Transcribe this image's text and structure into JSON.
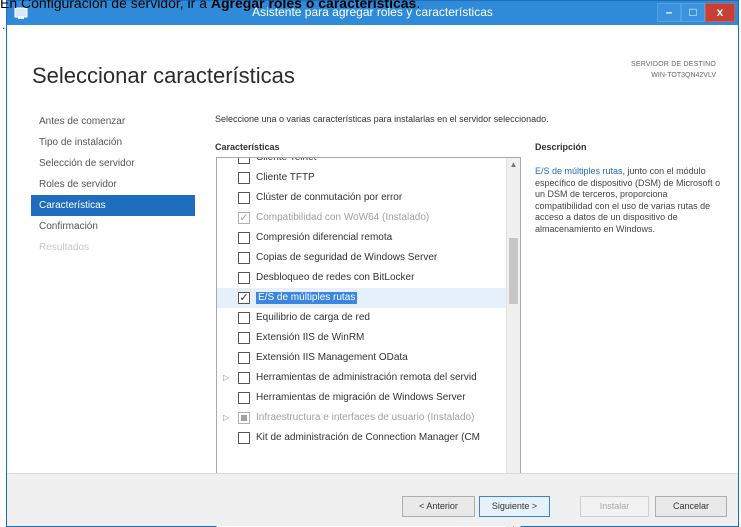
{
  "caption": {
    "prefix": "En Configuración de servidor, ir a ",
    "bold": "Agregar roles o características",
    "suffix": ".",
    "stray": "."
  },
  "window": {
    "title": "Asistente para agregar roles y características",
    "minimize_label": "–",
    "maximize_label": "□",
    "close_label": "x"
  },
  "header": {
    "title": "Seleccionar características",
    "destination_label": "SERVIDOR DE DESTINO",
    "destination_value": "WIN-TOT3QN42VLV"
  },
  "nav": {
    "items": [
      {
        "label": "Antes de comenzar",
        "state": "normal"
      },
      {
        "label": "Tipo de instalación",
        "state": "normal"
      },
      {
        "label": "Selección de servidor",
        "state": "normal"
      },
      {
        "label": "Roles de servidor",
        "state": "normal"
      },
      {
        "label": "Características",
        "state": "active"
      },
      {
        "label": "Confirmación",
        "state": "normal"
      },
      {
        "label": "Resultados",
        "state": "disabled"
      }
    ]
  },
  "main": {
    "instruction": "Seleccione una o varias características para instalarlas en el servidor seleccionado.",
    "features_heading": "Características",
    "description_heading": "Descripción"
  },
  "features": [
    {
      "label": "Cliente Telnet",
      "checked": false,
      "disabled": false,
      "expander": false,
      "selected": false
    },
    {
      "label": "Cliente TFTP",
      "checked": false,
      "disabled": false,
      "expander": false,
      "selected": false
    },
    {
      "label": "Clúster de conmutación por error",
      "checked": false,
      "disabled": false,
      "expander": false,
      "selected": false
    },
    {
      "label": "Compatibilidad con WoW64 (Instalado)",
      "checked": true,
      "disabled": true,
      "expander": false,
      "selected": false
    },
    {
      "label": "Compresión diferencial remota",
      "checked": false,
      "disabled": false,
      "expander": false,
      "selected": false
    },
    {
      "label": "Copias de seguridad de Windows Server",
      "checked": false,
      "disabled": false,
      "expander": false,
      "selected": false
    },
    {
      "label": "Desbloqueo de redes con BitLocker",
      "checked": false,
      "disabled": false,
      "expander": false,
      "selected": false
    },
    {
      "label": "E/S de múltiples rutas",
      "checked": true,
      "disabled": false,
      "expander": false,
      "selected": true
    },
    {
      "label": "Equilibrio de carga de red",
      "checked": false,
      "disabled": false,
      "expander": false,
      "selected": false
    },
    {
      "label": "Extensión IIS de WinRM",
      "checked": false,
      "disabled": false,
      "expander": false,
      "selected": false
    },
    {
      "label": "Extensión IIS Management OData",
      "checked": false,
      "disabled": false,
      "expander": false,
      "selected": false
    },
    {
      "label": "Herramientas de administración remota del servid",
      "checked": false,
      "disabled": false,
      "expander": true,
      "selected": false
    },
    {
      "label": "Herramientas de migración de Windows Server",
      "checked": false,
      "disabled": false,
      "expander": false,
      "selected": false
    },
    {
      "label": "Infraestructura e interfaces de usuario (Instalado)",
      "checked": false,
      "partial": true,
      "disabled": true,
      "expander": true,
      "selected": false
    },
    {
      "label": "Kit de administración de Connection Manager (CM",
      "checked": false,
      "disabled": false,
      "expander": false,
      "selected": false
    }
  ],
  "description": {
    "link_text": "E/S de múltiples rutas",
    "body": ", junto con el módulo específico de dispositivo (DSM) de Microsoft o un DSM de terceros, proporciona compatibilidad con el uso de varias rutas de acceso a datos de un dispositivo de almacenamiento en Windows."
  },
  "footer": {
    "prev": "< Anterior",
    "next": "Siguiente >",
    "install": "Instalar",
    "cancel": "Cancelar"
  },
  "colors": {
    "titlebar": "#2f8bd8",
    "nav_active": "#1e6dbf",
    "selection": "#3b86e0",
    "close": "#c74035"
  }
}
